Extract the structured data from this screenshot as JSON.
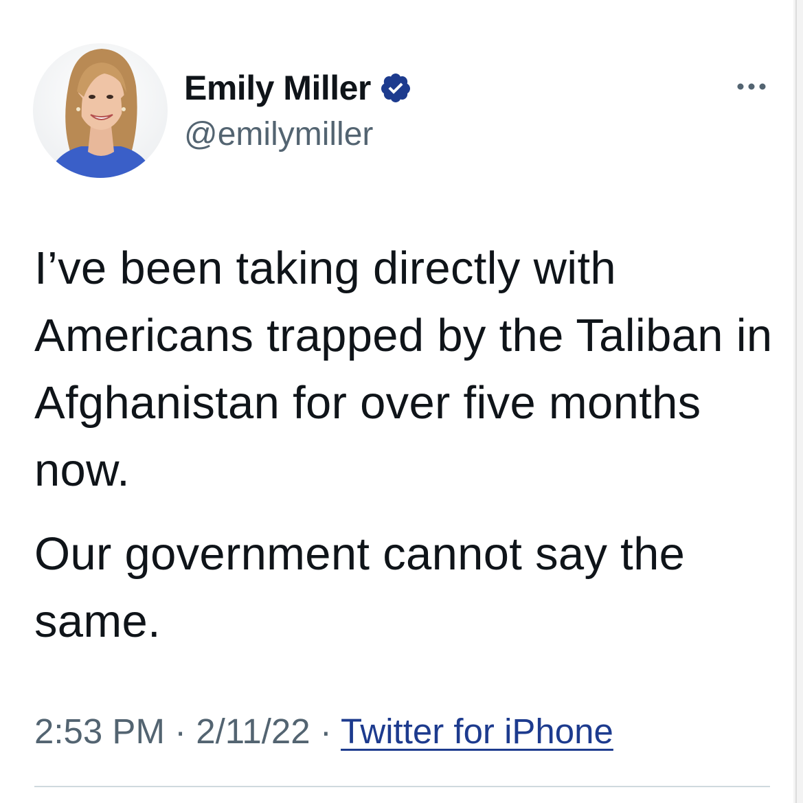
{
  "tweet": {
    "author_name": "Emily Miller",
    "handle": "@emilymiller",
    "verified": true,
    "paragraphs": [
      "I’ve been taking directly with Americans trapped by the Taliban in Afghanistan for over five months now.",
      "Our government cannot say the same."
    ],
    "time": "2:53 PM",
    "date": "2/11/22",
    "separator": "·",
    "source": "Twitter for iPhone"
  },
  "icons": {
    "verified": "verified-badge-icon",
    "more": "more-options-icon"
  },
  "colors": {
    "text": "#0f1419",
    "secondary": "#536471",
    "verified": "#1d3b8e",
    "link": "#1d3b8e",
    "divider": "#cfd9de"
  }
}
